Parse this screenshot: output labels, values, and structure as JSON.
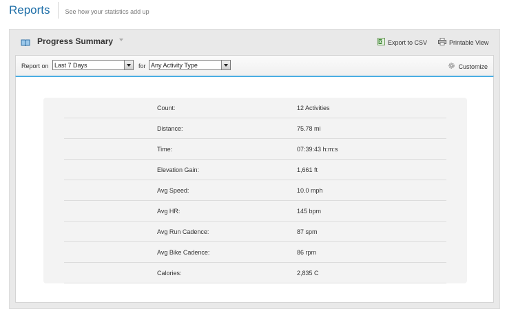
{
  "header": {
    "title": "Reports",
    "subtitle": "See how your statistics add up"
  },
  "panel": {
    "title": "Progress Summary",
    "export_csv": "Export to CSV",
    "printable_view": "Printable View"
  },
  "filters": {
    "report_on_label": "Report on",
    "range_value": "Last 7 Days",
    "for_label": "for",
    "activity_type_value": "Any Activity Type",
    "customize": "Customize"
  },
  "stats": [
    {
      "label": "Count:",
      "value": "12 Activities"
    },
    {
      "label": "Distance:",
      "value": "75.78 mi"
    },
    {
      "label": "Time:",
      "value": "07:39:43 h:m:s"
    },
    {
      "label": "Elevation Gain:",
      "value": "1,661 ft"
    },
    {
      "label": "Avg Speed:",
      "value": "10.0 mph"
    },
    {
      "label": "Avg HR:",
      "value": "145 bpm"
    },
    {
      "label": "Avg Run Cadence:",
      "value": "87 spm"
    },
    {
      "label": "Avg Bike Cadence:",
      "value": "86 rpm"
    },
    {
      "label": "Calories:",
      "value": "2,835 C"
    }
  ],
  "colors": {
    "title_blue": "#1f6fa8",
    "accent_rule": "#4aaee3",
    "panel_bg": "#e9e9e9",
    "stats_bg": "#f3f3f3"
  }
}
